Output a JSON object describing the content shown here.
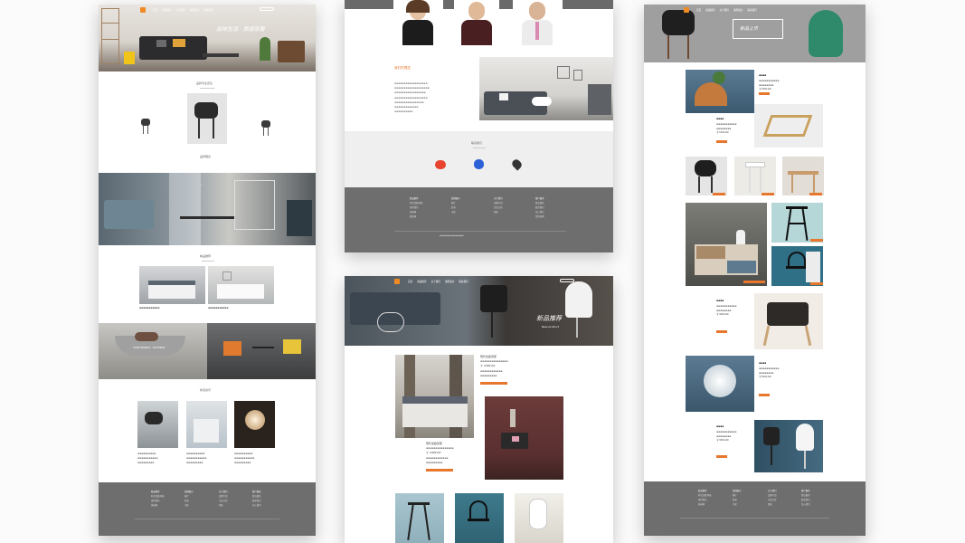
{
  "page1": {
    "nav": [
      "首页",
      "新品推荐",
      "关于我们",
      "案例展示",
      "联系我们"
    ],
    "hero_slogan": "品味生活 · 质感家居",
    "section1_title": "品牌专业定位",
    "section2_title": "品牌理念",
    "section3_title": "精品推荐",
    "overlay_caption": "COMFORTABLE · SOFTNESS",
    "section4_title": "新闻资讯",
    "footer_cols": [
      {
        "head": "新品推荐",
        "items": [
          "时尚北欧风格",
          "现代简约",
          "休闲椅",
          "餐桌椅"
        ]
      },
      {
        "head": "案例展示",
        "items": [
          "客厅",
          "卧室",
          "书房"
        ]
      },
      {
        "head": "关于我们",
        "items": [
          "品牌介绍",
          "企业文化",
          "团队"
        ]
      },
      {
        "head": "客户服务",
        "items": [
          "售后服务",
          "联系我们",
          "加入我们",
          "常见问题"
        ]
      }
    ]
  },
  "page2": {
    "about_title": "我们的理念",
    "contact_title": "联系我们",
    "footer_cols": [
      {
        "head": "新品推荐",
        "items": [
          "时尚北欧风格",
          "现代简约",
          "休闲椅",
          "餐桌椅"
        ]
      },
      {
        "head": "案例展示",
        "items": [
          "客厅",
          "卧室",
          "书房"
        ]
      },
      {
        "head": "关于我们",
        "items": [
          "品牌介绍",
          "企业文化",
          "团队"
        ]
      },
      {
        "head": "客户服务",
        "items": [
          "售后服务",
          "联系我们",
          "加入我们",
          "常见问题"
        ]
      }
    ]
  },
  "page3": {
    "hero_title": "新品推荐",
    "hero_sub": "New product",
    "product1_name": "现代北欧风床",
    "product1_price": "￥ 2499.00",
    "product2_name": "现代北欧风床",
    "product2_price": "￥ 2499.00"
  },
  "page4": {
    "hero_title": "新品上市",
    "prices": [
      "￥299.00",
      "￥199.00",
      "￥399.00",
      "￥599.00",
      "￥399.00"
    ],
    "footer_cols": [
      {
        "head": "新品推荐",
        "items": [
          "时尚北欧风格",
          "现代简约",
          "休闲椅",
          "餐桌椅"
        ]
      },
      {
        "head": "案例展示",
        "items": [
          "客厅",
          "卧室",
          "书房"
        ]
      },
      {
        "head": "关于我们",
        "items": [
          "品牌介绍",
          "企业文化",
          "团队"
        ]
      },
      {
        "head": "客户服务",
        "items": [
          "售后服务",
          "联系我们",
          "加入我们",
          "常见问题"
        ]
      }
    ]
  }
}
